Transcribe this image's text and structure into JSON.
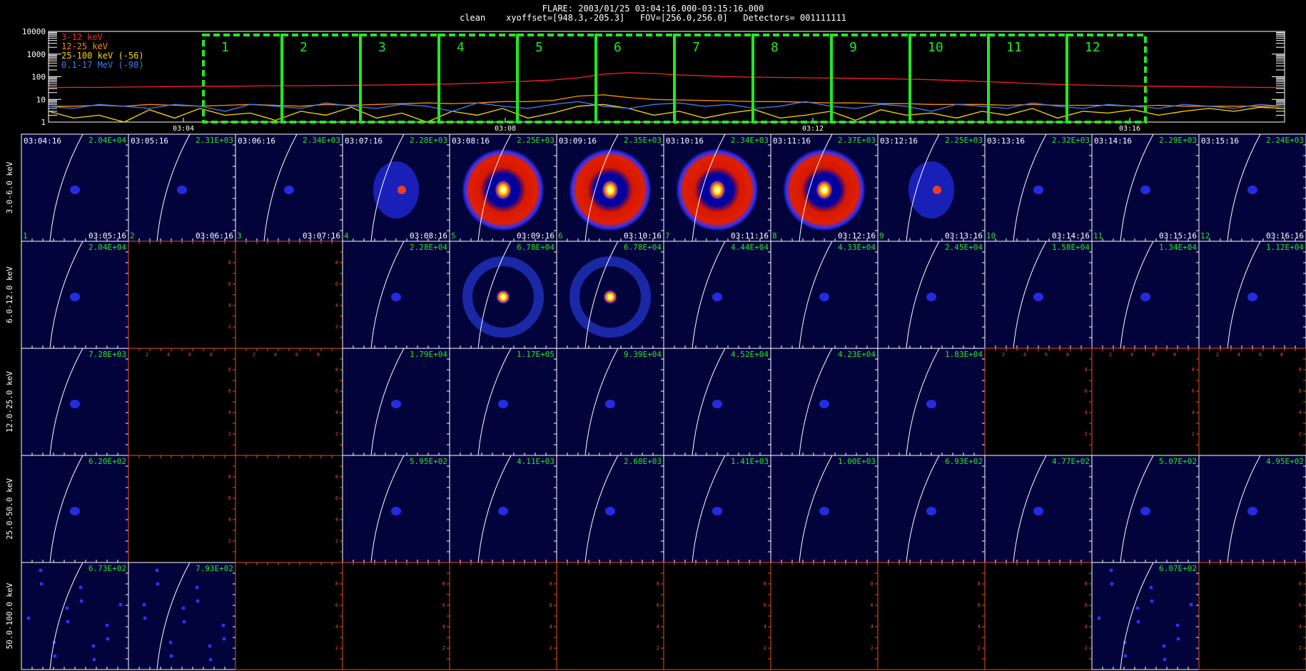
{
  "header": {
    "title": "FLARE: 2003/01/25 03:04:16.000-03:15:16.000",
    "subtitle": "clean    xyoffset=[948.3,-205.3]   FOV=[256.0,256.0]   Detectors= 001111111"
  },
  "chart_data": [
    {
      "type": "line",
      "yscale": "log",
      "ylim": [
        1,
        10000
      ],
      "ytick_labels": [
        "10000",
        "1000",
        "100",
        "10",
        "1"
      ],
      "xtick_labels": [
        "03:04",
        "03:08",
        "03:12",
        "03:16"
      ],
      "legend_position": "top-left",
      "series": [
        {
          "name": "3-12 keV",
          "color": "#ff2020",
          "values": [
            33,
            34,
            34,
            35,
            36,
            37,
            38,
            38,
            39,
            40,
            40,
            41,
            42,
            43,
            44,
            46,
            48,
            52,
            58,
            64,
            72,
            90,
            130,
            150,
            140,
            120,
            110,
            100,
            96,
            93,
            90,
            88,
            85,
            82,
            78,
            74,
            68,
            62,
            56,
            50,
            46,
            43,
            41,
            39,
            38,
            37,
            36,
            35,
            34,
            33
          ]
        },
        {
          "name": "12-25 keV",
          "color": "#ff8c00",
          "values": [
            5,
            5,
            5.5,
            5,
            6,
            5.5,
            5,
            5.5,
            6,
            5.5,
            5,
            6,
            5.5,
            6,
            6.5,
            7,
            6.5,
            7,
            8,
            8,
            9,
            14,
            16,
            12,
            10,
            9.5,
            9,
            8.5,
            8,
            8,
            7.5,
            7,
            7,
            6.5,
            6.5,
            6,
            6,
            6,
            5.5,
            6,
            5.5,
            5.5,
            5.5,
            5,
            5.5,
            5,
            5,
            5,
            5,
            5
          ]
        },
        {
          "name": "25-100 keV (-56)",
          "color": "#ffd700",
          "values": [
            3,
            1.5,
            2,
            1,
            3.5,
            1.5,
            4,
            2,
            2.5,
            1.2,
            3,
            2,
            4.5,
            1.5,
            2.5,
            1,
            3,
            2,
            4,
            1.5,
            2.5,
            5,
            6,
            4,
            2,
            3,
            1.5,
            2.5,
            3.5,
            1.5,
            2,
            3,
            1.2,
            3.5,
            2,
            2.5,
            1.5,
            3,
            2,
            4,
            1.5,
            3,
            2.5,
            3.5,
            2,
            3,
            4,
            3,
            4.5,
            4
          ]
        },
        {
          "name": "0.1-17 MeV (-98)",
          "color": "#3a7cff",
          "values": [
            5,
            4,
            6,
            5,
            4,
            6,
            5,
            3,
            6,
            5,
            4,
            7,
            5,
            4,
            6,
            5,
            3,
            7,
            5,
            4,
            6,
            8,
            5,
            4,
            6,
            7,
            5,
            6,
            4,
            5,
            8,
            5,
            4,
            6,
            5,
            3,
            6,
            5,
            4,
            7,
            5,
            4,
            6,
            5,
            4,
            6,
            5,
            4,
            6,
            5
          ]
        }
      ],
      "intervals": [
        "1",
        "2",
        "3",
        "4",
        "5",
        "6",
        "7",
        "8",
        "9",
        "10",
        "11",
        "12"
      ]
    },
    {
      "type": "heatmap",
      "rows": [
        "3.0-6.0 keV",
        "6.0-12.0 keV",
        "12.0-25.0 keV",
        "25.0-50.0 keV",
        "50.0-100.0 keV"
      ],
      "cols": [
        "03:04:16",
        "03:05:16",
        "03:06:16",
        "03:07:16",
        "03:08:16",
        "03:09:16",
        "03:10:16",
        "03:11:16",
        "03:12:16",
        "03:13:16",
        "03:14:16",
        "03:15:16"
      ],
      "end_times": [
        "03:05:16",
        "03:06:16",
        "03:07:16",
        "03:08:16",
        "03:09:16",
        "03:10:16",
        "03:11:16",
        "03:12:16",
        "03:13:16",
        "03:14:16",
        "03:15:16",
        "03:16:16"
      ],
      "panel_numbers": [
        "1",
        "2",
        "3",
        "4",
        "5",
        "6",
        "7",
        "8",
        "9",
        "10",
        "11",
        "12"
      ],
      "max_values": [
        [
          "2.04E+04",
          "2.31E+03",
          "2.34E+03",
          "2.28E+03",
          "2.25E+03",
          "2.35E+03",
          "2.34E+03",
          "2.37E+03",
          "2.25E+03",
          "2.32E+03",
          "2.29E+03",
          "2.24E+03"
        ],
        [
          "2.04E+04",
          "",
          "",
          "2.28E+04",
          "6.78E+04",
          "6.78E+04",
          "4.44E+04",
          "4.33E+04",
          "2.45E+04",
          "1.58E+04",
          "1.34E+04",
          "1.12E+04"
        ],
        [
          "7.28E+03",
          "",
          "",
          "1.79E+04",
          "1.17E+05",
          "9.39E+04",
          "4.52E+04",
          "4.23E+04",
          "1.83E+04",
          "",
          "",
          ""
        ],
        [
          "6.20E+02",
          "",
          "",
          "5.95E+02",
          "4.11E+03",
          "2.68E+03",
          "1.41E+03",
          "1.00E+03",
          "6.93E+02",
          "4.77E+02",
          "5.07E+02",
          "4.95E+02"
        ],
        [
          "6.73E+02",
          "7.93E+02",
          "",
          "",
          "",
          "",
          "",
          "",
          "",
          "",
          "6.07E+02",
          ""
        ]
      ],
      "sources": [
        [
          "faint",
          "faint",
          "faint",
          "blob",
          "ring",
          "ring",
          "ring",
          "ring",
          "blob",
          "faint",
          "faint",
          "faint"
        ],
        [
          "faint",
          "empty",
          "empty",
          "faint",
          "ring",
          "ring",
          "faint",
          "faint",
          "faint",
          "faint",
          "faint",
          "faint"
        ],
        [
          "faint",
          "empty",
          "empty",
          "faint",
          "faint",
          "faint",
          "faint",
          "faint",
          "faint",
          "empty",
          "empty",
          "empty"
        ],
        [
          "faint",
          "empty",
          "empty",
          "faint",
          "faint",
          "faint",
          "faint",
          "faint",
          "faint",
          "faint",
          "faint",
          "faint"
        ],
        [
          "noise",
          "noise",
          "empty",
          "empty",
          "empty",
          "empty",
          "empty",
          "empty",
          "empty",
          "empty",
          "noise",
          "empty"
        ]
      ],
      "empty_axis_ticks": [
        "2",
        "4",
        "6",
        "8"
      ],
      "colors": {
        "map_background": "#03033c",
        "empty_axis": "#e8501a",
        "label": "#22e822"
      }
    }
  ]
}
